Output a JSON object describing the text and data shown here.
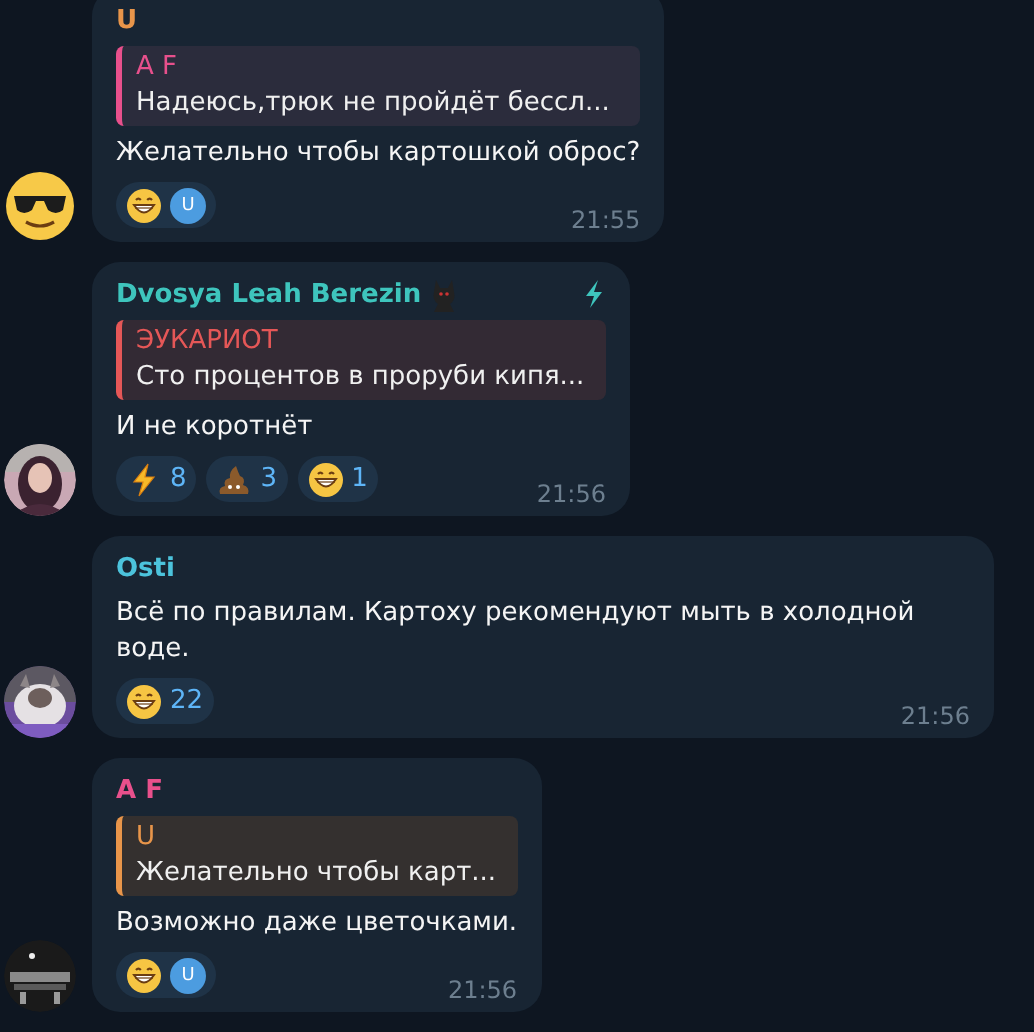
{
  "messages": [
    {
      "avatar": {
        "kind": "emoji"
      },
      "sender": {
        "name": "U",
        "color": "#e8954a"
      },
      "reply": {
        "name": "A F",
        "color": "#e8508c",
        "text": "Надеюсь,трюк не пройдёт бессл..."
      },
      "text": "Желательно чтобы картошкой оброс?",
      "reactions": [
        {
          "kind": "grin",
          "reactors": [
            {
              "initial": "U"
            }
          ]
        }
      ],
      "time": "21:55"
    },
    {
      "avatar": {
        "kind": "picture"
      },
      "sender": {
        "name": "Dvosya Leah Berezin",
        "color": "#3ec5bd",
        "badge": true,
        "boost": true
      },
      "reply": {
        "name": "ЭУКАРИОТ",
        "color": "#e55757",
        "text": "Сто процентов в проруби кипя..."
      },
      "text": "И не коротнёт",
      "reactions": [
        {
          "kind": "bolt",
          "count": "8"
        },
        {
          "kind": "poop",
          "count": "3"
        },
        {
          "kind": "grin",
          "count": "1"
        }
      ],
      "time": "21:56"
    },
    {
      "avatar": {
        "kind": "picture"
      },
      "sender": {
        "name": "Osti",
        "color": "#4cc3dc"
      },
      "text": "Всё по правилам. Картоху рекомендуют мыть в холодной воде.",
      "reactions": [
        {
          "kind": "grin",
          "count": "22"
        }
      ],
      "time": "21:56"
    },
    {
      "avatar": {
        "kind": "picture"
      },
      "sender": {
        "name": "A F",
        "color": "#e8508c"
      },
      "reply": {
        "name": "U",
        "color": "#e8954a",
        "text": "Желательно чтобы карт..."
      },
      "text": "Возможно даже цветочками.",
      "reactions": [
        {
          "kind": "grin",
          "reactors": [
            {
              "initial": "U"
            }
          ]
        }
      ],
      "time": "21:56"
    }
  ]
}
